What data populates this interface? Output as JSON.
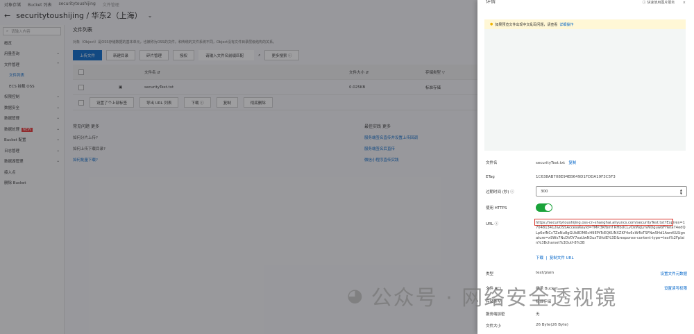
{
  "breadcrumb": [
    "对象存储",
    "Bucket 列表",
    "securitytoushijing",
    "文件管理"
  ],
  "title": "securitytoushijing / 华东2（上海）",
  "sidebar": {
    "search_placeholder": "请输入内容",
    "items": [
      {
        "label": "概览"
      },
      {
        "label": "用量查询",
        "chev": "⌄"
      },
      {
        "label": "文件管理",
        "chev": "⌃"
      },
      {
        "label": "文件列表",
        "sub": true,
        "active": true
      },
      {
        "label": "ECS 挂载 OSS",
        "sub": true
      },
      {
        "label": "权限控制",
        "chev": "⌄"
      },
      {
        "label": "数据安全",
        "chev": "⌄"
      },
      {
        "label": "数据管理",
        "chev": "⌄"
      },
      {
        "label": "数据处理",
        "badge": "NEW",
        "chev": "⌄"
      },
      {
        "label": "Bucket 配置",
        "chev": "⌄"
      },
      {
        "label": "日志管理",
        "chev": "⌄"
      },
      {
        "label": "数据湖管理",
        "chev": "⌄"
      },
      {
        "label": "接入点"
      },
      {
        "label": "删除 Bucket"
      }
    ]
  },
  "main": {
    "heading": "文件列表",
    "description": "对象（Object）是OSS存储数据的基本单元，也被称为OSS的文件。和传统的文件系统不同，Object没有文件目录层级结构的关系。",
    "toolbar": {
      "upload": "上传文件",
      "new_dir": "新建目录",
      "fragments": "碎片管理",
      "auth": "授权",
      "search_placeholder": "请输入文件名前缀匹配",
      "more_search": "更多搜索 ⓘ"
    },
    "columns": {
      "name": "文件名 ⇵",
      "size": "文件大小 ⇵",
      "storage": "存储类型 ▽"
    },
    "rows": [
      {
        "name": "securityTest.txt",
        "size": "0.025KB",
        "storage": "标准存储"
      }
    ],
    "bulk": [
      "设置了个上部标签",
      "导出 URL 列表",
      "下载 ⓘ",
      "复制",
      "彻底删除"
    ],
    "faq": {
      "title": "常见问题",
      "more": "更多",
      "items": [
        "如何分片上传?",
        "如何上传下载目录?",
        "如何批量下载?"
      ]
    },
    "best": {
      "title": "最佳实践",
      "more": "更多",
      "items": [
        "服务端签名直传并设置上传回调",
        "服务端签名后直传",
        "微信小程序直传实践"
      ]
    }
  },
  "drawer": {
    "title": "详情",
    "help": "ⓘ 快速使用图片服务",
    "notice": "如果预览文件出现中文乱码问题，请查看",
    "notice_link": "详细操作",
    "fields": {
      "name_k": "文件名",
      "name_v": "securityTest.txt",
      "copy": "复制",
      "etag_k": "ETag",
      "etag_v": "1C638AB708E94EB649D1FDDA19F3C5F3",
      "expire_k": "过期时间 (秒) ⓘ",
      "expire_v": "300",
      "https_k": "使用 HTTPS",
      "https_on": true,
      "url_k": "URL ⓘ",
      "url_v": "https://securitytoushijing.oss-cn-shanghai.aliyuncs.com/securityTest.txt?Expires=1704813412&OSSAccessKeyId=TMP.3Kfbmf RHbUCLvDzWqLmWDguwbFHetaT4edQLp6efNCcTZeNu8gGUk8DMEcH9EPtTcEQKUNXZKF4o6cW4bTSFNw5Hd1AwnK&Signature=x9Ws7NcDV0Y7xaUwN3uxTUfoIE%3D&response-content-type=text%2Fplain%3Bcharset%3Dutf-8%3B",
      "download": "下载",
      "copy_url": "复制文件 URL",
      "type_k": "类型",
      "type_v": "text/plain",
      "set_meta": "设置文件元数据",
      "acl_k": "文件 ACL",
      "acl_v": "继承 Bucket",
      "set_acl": "设置读写权限",
      "storage_k": "存储类型",
      "storage_v": "标准存储",
      "enc_k": "服务端加密",
      "enc_v": "无",
      "size_k": "文件大小",
      "size_v": "26 Byte(26 Byte)"
    }
  },
  "watermark": "公众号 · 网络安全透视镜",
  "colors": {
    "primary": "#0064c8",
    "toggle": "#1aa33a",
    "highlight": "#d9352b"
  }
}
